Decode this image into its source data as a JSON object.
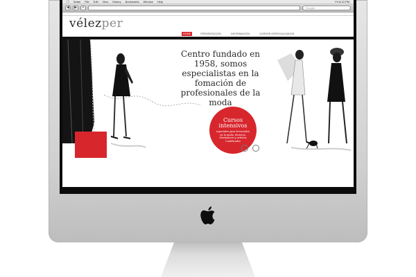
{
  "menubar": {
    "app": "Safari",
    "items": [
      "File",
      "Edit",
      "View",
      "History",
      "Bookmarks",
      "Window",
      "Help"
    ],
    "clock": "Fri 6:13 PM"
  },
  "browser": {
    "search_placeholder": "Google"
  },
  "site": {
    "logo_part1": "vélez",
    "logo_part2": "per",
    "nav": [
      "HOME",
      "PRESENTACIÓN",
      "INFORMACIÓN",
      "CURSOS ESPECIALIZADOS"
    ],
    "headline": "Centro fundado en 1958, somos especialistas en la fomación de profesionales de la moda",
    "badge_title": "Cursos intensivos",
    "badge_text": "especiales para licenciados en la moda, técnicos, diseñadores y artistas Cualificados"
  },
  "colors": {
    "accent_red": "#d8262d",
    "band_black": "#111111"
  }
}
